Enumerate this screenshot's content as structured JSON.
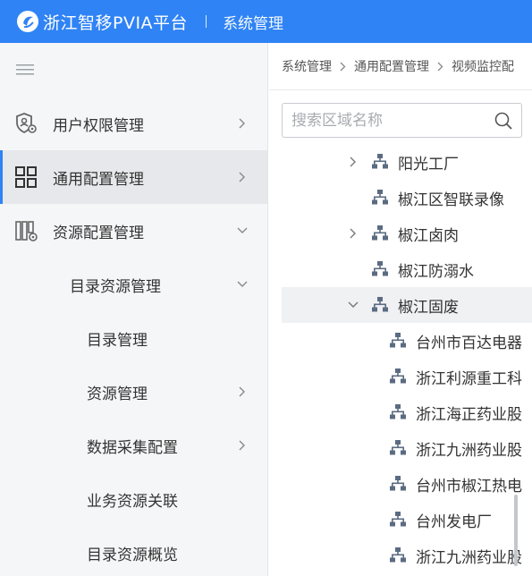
{
  "topbar": {
    "app_name": "浙江智移PVIA平台",
    "separator": "|",
    "section_title": "系统管理",
    "brand_color": "#2f83f5"
  },
  "sidebar": {
    "collapse_icon": "menu-collapse-icon",
    "items": [
      {
        "label": "用户权限管理",
        "icon": "user-permission-icon",
        "arrow": "chevron-right-icon",
        "level": 0,
        "active": false
      },
      {
        "label": "通用配置管理",
        "icon": "grid-config-icon",
        "arrow": "chevron-right-icon",
        "level": 0,
        "active": true
      },
      {
        "label": "资源配置管理",
        "icon": "resource-config-icon",
        "arrow": "chevron-down-icon",
        "level": 0,
        "active": false
      },
      {
        "label": "目录资源管理",
        "arrow": "chevron-down-icon",
        "level": 1,
        "active": false
      },
      {
        "label": "目录管理",
        "level": 2,
        "active": false
      },
      {
        "label": "资源管理",
        "arrow": "chevron-right-icon",
        "level": 2,
        "active": false
      },
      {
        "label": "数据采集配置",
        "arrow": "chevron-right-icon",
        "level": 2,
        "active": false
      },
      {
        "label": "业务资源关联",
        "level": 2,
        "active": false
      },
      {
        "label": "目录资源概览",
        "level": 2,
        "active": false
      }
    ]
  },
  "breadcrumb": {
    "items": [
      "系统管理",
      "通用配置管理",
      "视频监控配"
    ]
  },
  "search": {
    "placeholder": "搜索区域名称",
    "value": ""
  },
  "tree": {
    "nodes": [
      {
        "label": "阳光工厂",
        "level": 0,
        "caret": "chevron-right-icon",
        "highlight": false
      },
      {
        "label": "椒江区智联录像",
        "level": 0,
        "caret": "",
        "highlight": false
      },
      {
        "label": "椒江卤肉",
        "level": 0,
        "caret": "chevron-right-icon",
        "highlight": false
      },
      {
        "label": "椒江防溺水",
        "level": 0,
        "caret": "",
        "highlight": false
      },
      {
        "label": "椒江固废",
        "level": 0,
        "caret": "chevron-down-icon",
        "highlight": true
      },
      {
        "label": "台州市百达电器",
        "level": 1,
        "caret": "",
        "highlight": false
      },
      {
        "label": "浙江利源重工科",
        "level": 1,
        "caret": "",
        "highlight": false
      },
      {
        "label": "浙江海正药业股",
        "level": 1,
        "caret": "",
        "highlight": false
      },
      {
        "label": "浙江九洲药业股",
        "level": 1,
        "caret": "",
        "highlight": false
      },
      {
        "label": "台州市椒江热电",
        "level": 1,
        "caret": "",
        "highlight": false
      },
      {
        "label": "台州发电厂",
        "level": 1,
        "caret": "",
        "highlight": false
      },
      {
        "label": "浙江九洲药业股",
        "level": 1,
        "caret": "",
        "highlight": false
      }
    ]
  }
}
